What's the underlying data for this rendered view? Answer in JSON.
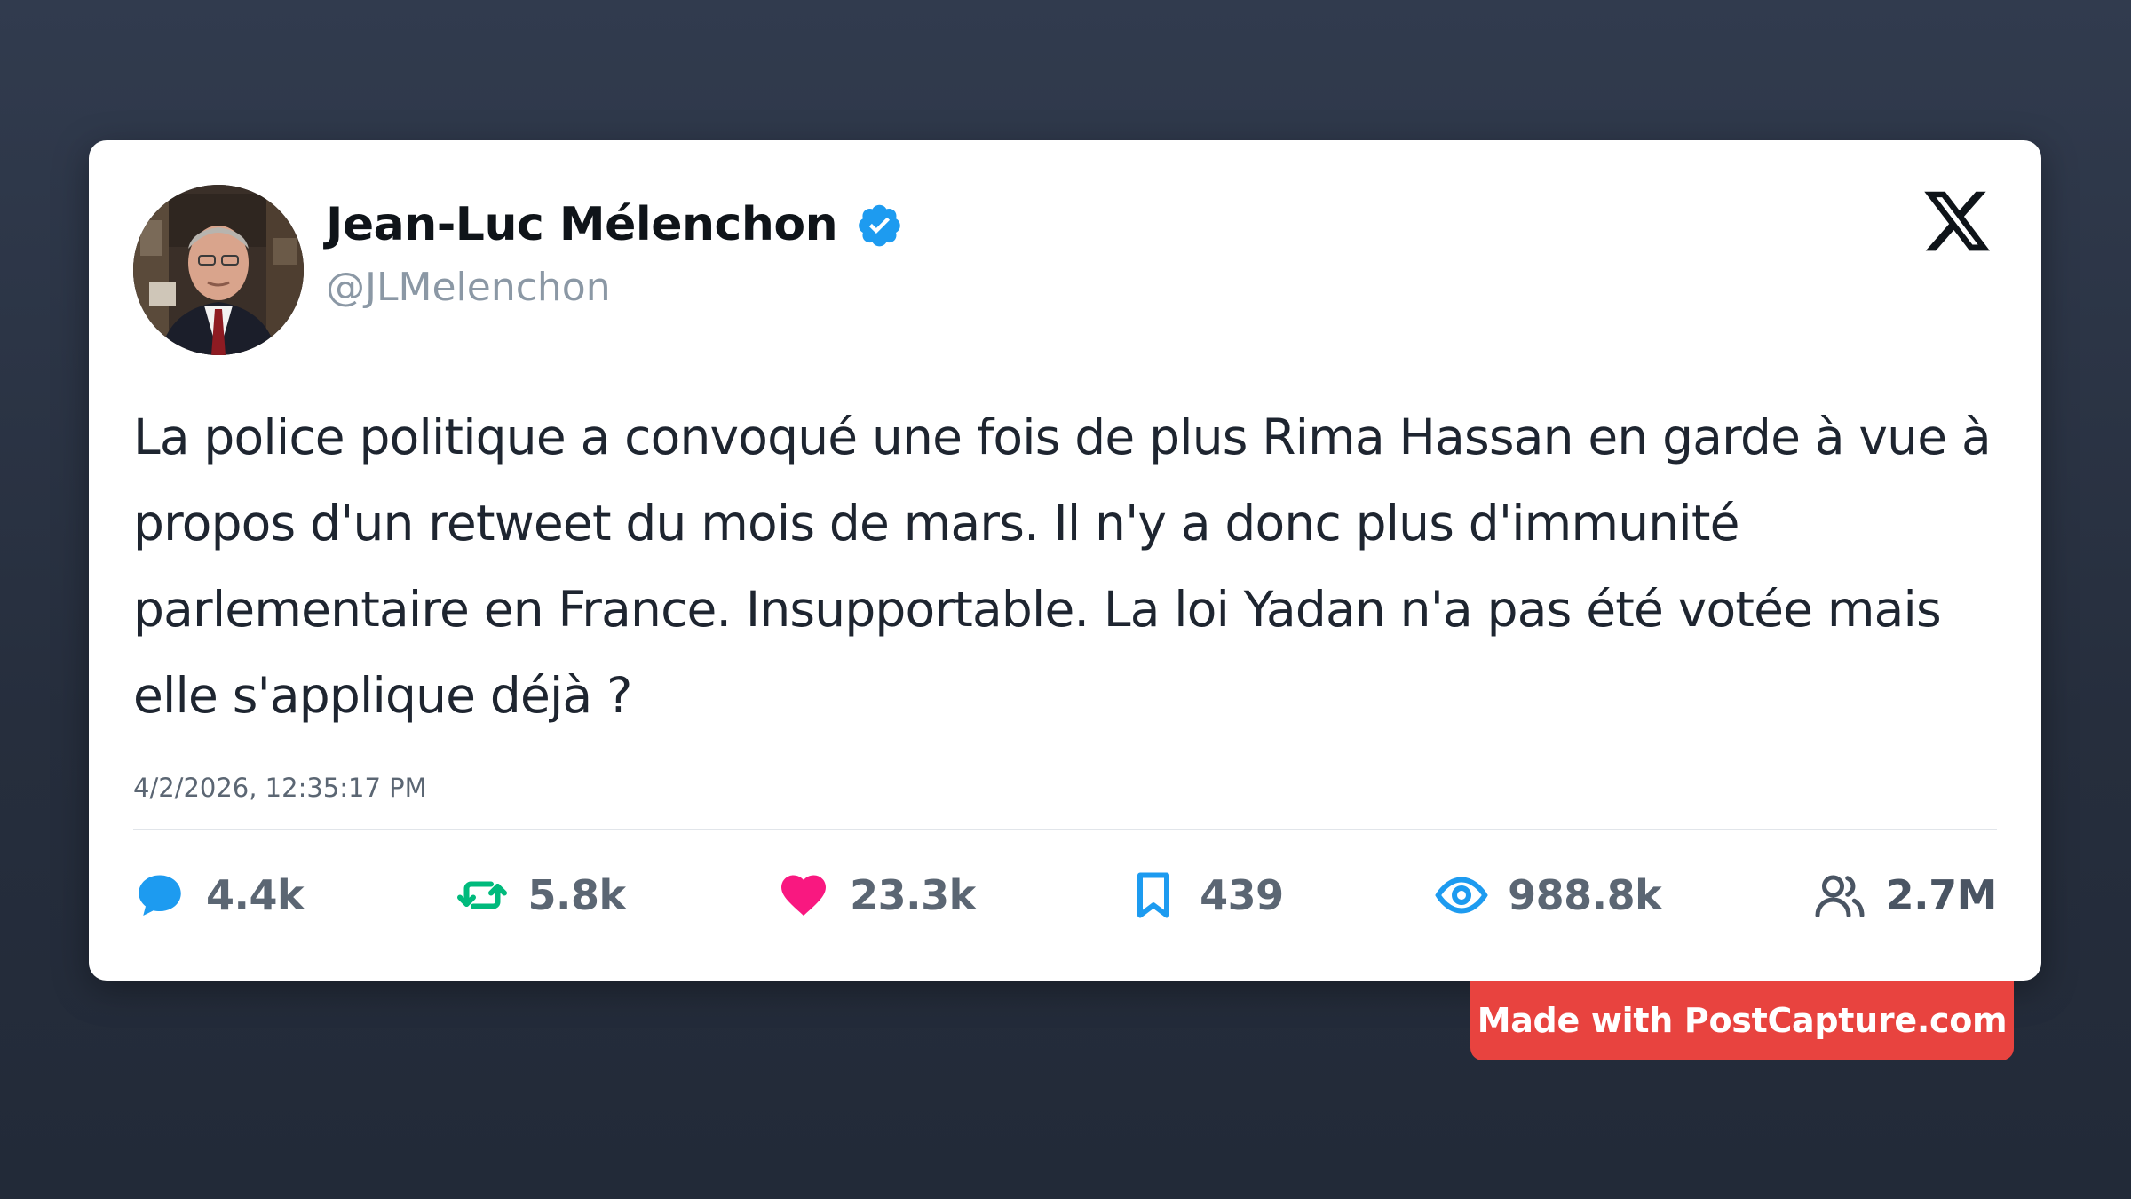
{
  "author": {
    "name": "Jean-Luc Mélenchon",
    "handle": "@JLMelenchon",
    "verified": true
  },
  "tweet": {
    "text": "La police politique a convoqué une fois de plus Rima Hassan en garde à vue à propos d'un retweet du mois de mars. Il n'y a donc plus d'immunité parlementaire en France. Insupportable. La loi Yadan n'a pas été votée mais elle s'applique déjà ?",
    "timestamp": "4/2/2026, 12:35:17 PM"
  },
  "stats": {
    "replies": "4.4k",
    "retweets": "5.8k",
    "likes": "23.3k",
    "bookmarks": "439",
    "views": "988.8k",
    "audience": "2.7M"
  },
  "icons": {
    "platform": "x-logo-icon",
    "verified": "verified-badge-icon",
    "replies": "comment-icon",
    "retweets": "retweet-icon",
    "likes": "heart-icon",
    "bookmarks": "bookmark-icon",
    "views": "eye-icon",
    "audience": "users-icon"
  },
  "colors": {
    "verified": "#1d9bf0",
    "replies": "#1d9bf0",
    "retweets": "#00ba7c",
    "likes": "#f91880",
    "bookmarks": "#1d9bf0",
    "views": "#1d9bf0",
    "badge": "#e8433f"
  },
  "watermark": {
    "label": "Made with PostCapture.com"
  }
}
